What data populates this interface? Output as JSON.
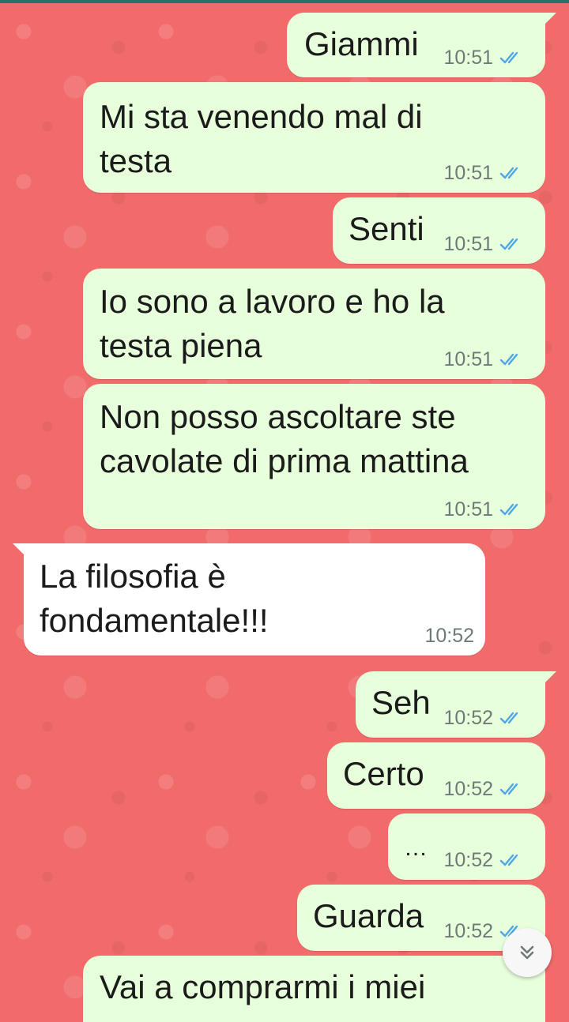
{
  "colors": {
    "wallpaper": "#F26B6B",
    "outgoing_bubble": "#E7FFDB",
    "incoming_bubble": "#FFFFFF",
    "read_ticks": "#4FA6E8",
    "timestamp": "#6E7A78"
  },
  "messages": [
    {
      "direction": "out",
      "text": "Giammi",
      "time": "10:51",
      "status": "read-double-check-icon"
    },
    {
      "direction": "out",
      "text": "Mi sta venendo mal di\ntesta",
      "time": "10:51",
      "status": "read-double-check-icon"
    },
    {
      "direction": "out",
      "text": "Senti",
      "time": "10:51",
      "status": "read-double-check-icon"
    },
    {
      "direction": "out",
      "text": "Io sono a lavoro e ho la\ntesta piena",
      "time": "10:51",
      "status": "read-double-check-icon"
    },
    {
      "direction": "out",
      "text": "Non posso ascoltare ste\ncavolate di prima mattina",
      "time": "10:51",
      "status": "read-double-check-icon"
    },
    {
      "direction": "in",
      "text": "La filosofia è\nfondamentale!!!",
      "time": "10:52"
    },
    {
      "direction": "out",
      "text": "Seh",
      "time": "10:52",
      "status": "read-double-check-icon"
    },
    {
      "direction": "out",
      "text": "Certo",
      "time": "10:52",
      "status": "read-double-check-icon"
    },
    {
      "direction": "out",
      "text": "…",
      "time": "10:52",
      "status": "read-double-check-icon"
    },
    {
      "direction": "out",
      "text": "Guarda",
      "time": "10:52",
      "status": "read-double-check-icon"
    },
    {
      "direction": "out",
      "text": "Vai a comprarmi i miei",
      "time": "",
      "status": ""
    }
  ],
  "scroll_button": {
    "icon": "double-chevron-down-icon"
  }
}
